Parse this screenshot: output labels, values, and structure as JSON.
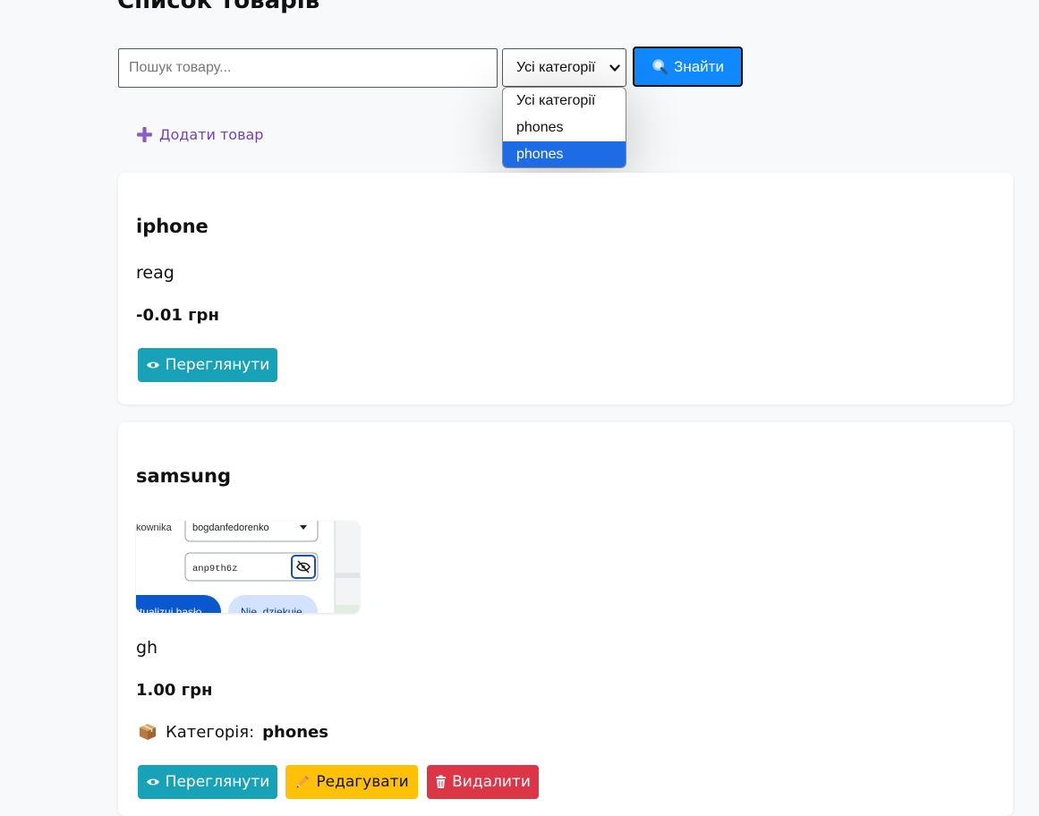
{
  "page": {
    "title": "Список товарів"
  },
  "search": {
    "placeholder": "Пошук товару...",
    "category_selected": "Усі категорії",
    "button_label": "Знайти",
    "dropdown_options": [
      "Усі категорії",
      "phones",
      "phones"
    ],
    "highlighted_option_index": 2
  },
  "add_product": {
    "label": "Додати товар"
  },
  "products": [
    {
      "name": "iphone",
      "description": "reag",
      "price": "-0.01 грн",
      "view_label": "Переглянути"
    },
    {
      "name": "samsung",
      "image": {
        "field_label": "kownika",
        "username": "bogdanfedorenko",
        "password": "anp9th6z",
        "primary_button": "ktualizuj hasło",
        "secondary_button": "Nie, dziękuję"
      },
      "description": "gh",
      "price": "1.00 грн",
      "category_label": "Категорія:",
      "category_value": "phones",
      "view_label": "Переглянути",
      "edit_label": "Редагувати",
      "delete_label": "Видалити"
    }
  ],
  "colors": {
    "search_button": "#1088ff",
    "dropdown_highlight": "#1d6ce6",
    "add_link": "#6f42c1",
    "view_button": "#17a2b8",
    "edit_button": "#ffc107",
    "delete_button": "#dc3545"
  },
  "icons": {
    "search_button": "magnifier-icon",
    "add": "plus-icon",
    "view": "eye-icon",
    "edit": "pencil-icon",
    "delete": "trash-icon",
    "category": "package-icon",
    "select": "chevron-down-icon"
  }
}
